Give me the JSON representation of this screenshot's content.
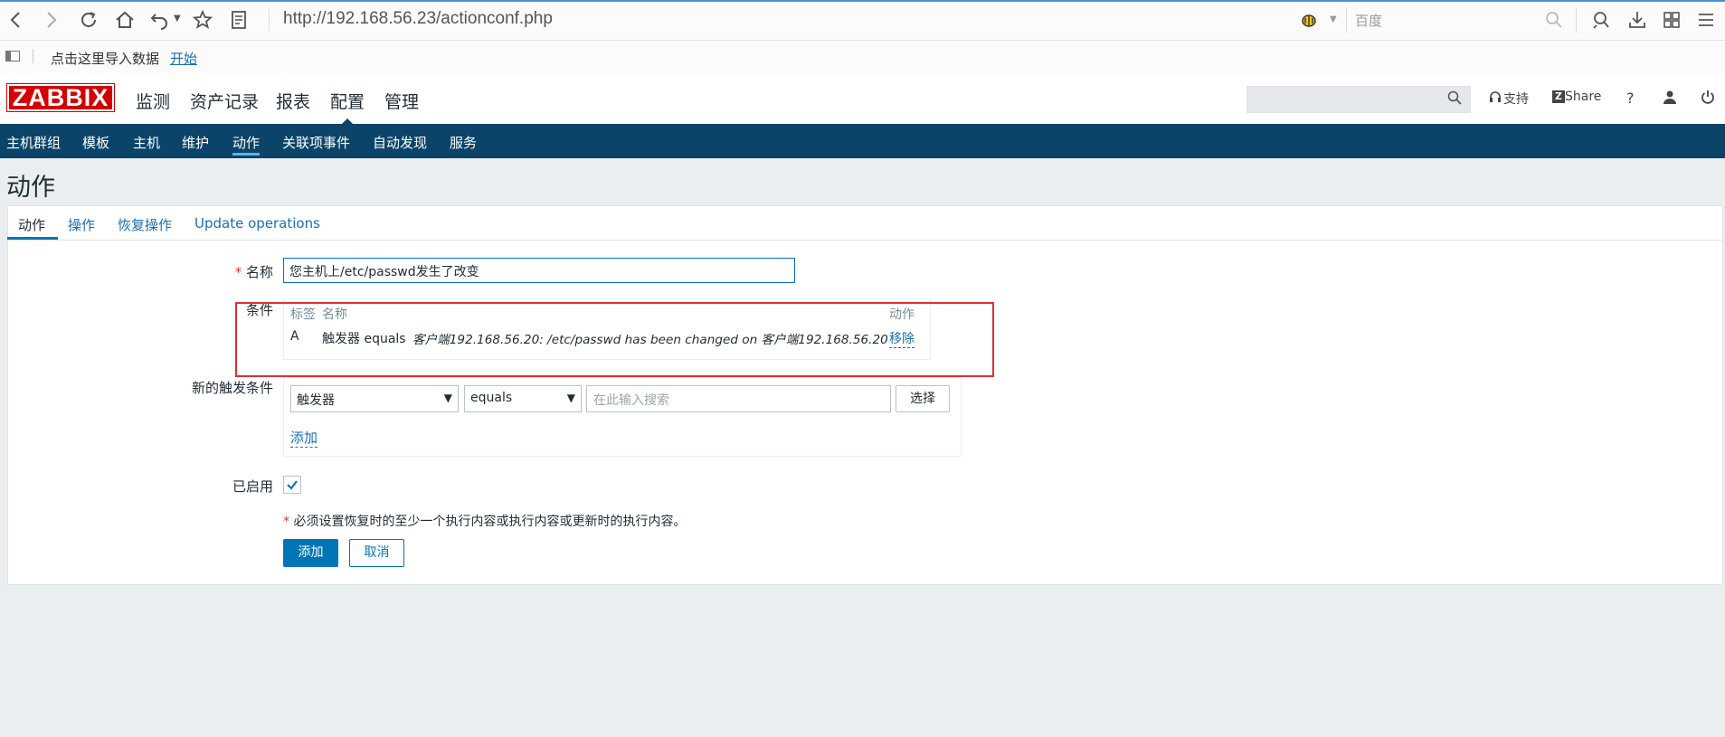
{
  "browser": {
    "url": "http://192.168.56.23/actionconf.php",
    "search_engine": "百度",
    "bookmark_text": "点击这里导入数据",
    "bookmark_link": "开始"
  },
  "header": {
    "logo": "ZABBIX",
    "nav": [
      "监测",
      "资产记录",
      "报表",
      "配置",
      "管理"
    ],
    "active_nav": "配置",
    "support": "支持",
    "share": "Share",
    "help": "?"
  },
  "subnav": {
    "items": [
      "主机群组",
      "模板",
      "主机",
      "维护",
      "动作",
      "关联项事件",
      "自动发现",
      "服务"
    ],
    "active": "动作"
  },
  "page_title": "动作",
  "tabs": {
    "items": [
      "动作",
      "操作",
      "恢复操作",
      "Update operations"
    ],
    "active": "动作"
  },
  "form": {
    "name_label": "名称",
    "name_value": "您主机上/etc/passwd发生了改变",
    "conditions_label": "条件",
    "conditions_header": {
      "tag": "标签",
      "name": "名称",
      "action": "动作"
    },
    "conditions": [
      {
        "tag": "A",
        "prefix": "触发器 equals",
        "value": "客户端192.168.56.20: /etc/passwd has been changed on 客户端192.168.56.20",
        "action": "移除"
      }
    ],
    "new_condition_label": "新的触发条件",
    "condition_type": "触发器",
    "operator": "equals",
    "search_placeholder": "在此输入搜索",
    "select_button": "选择",
    "add_link": "添加",
    "enabled_label": "已启用",
    "enabled": true,
    "note": "必须设置恢复时的至少一个执行内容或执行内容或更新时的执行内容。",
    "add_button": "添加",
    "cancel_button": "取消"
  },
  "colors": {
    "brand_red": "#d40000",
    "nav_dark": "#0b4468",
    "primary_blue": "#0275b8",
    "highlight_box": "#e03030"
  }
}
